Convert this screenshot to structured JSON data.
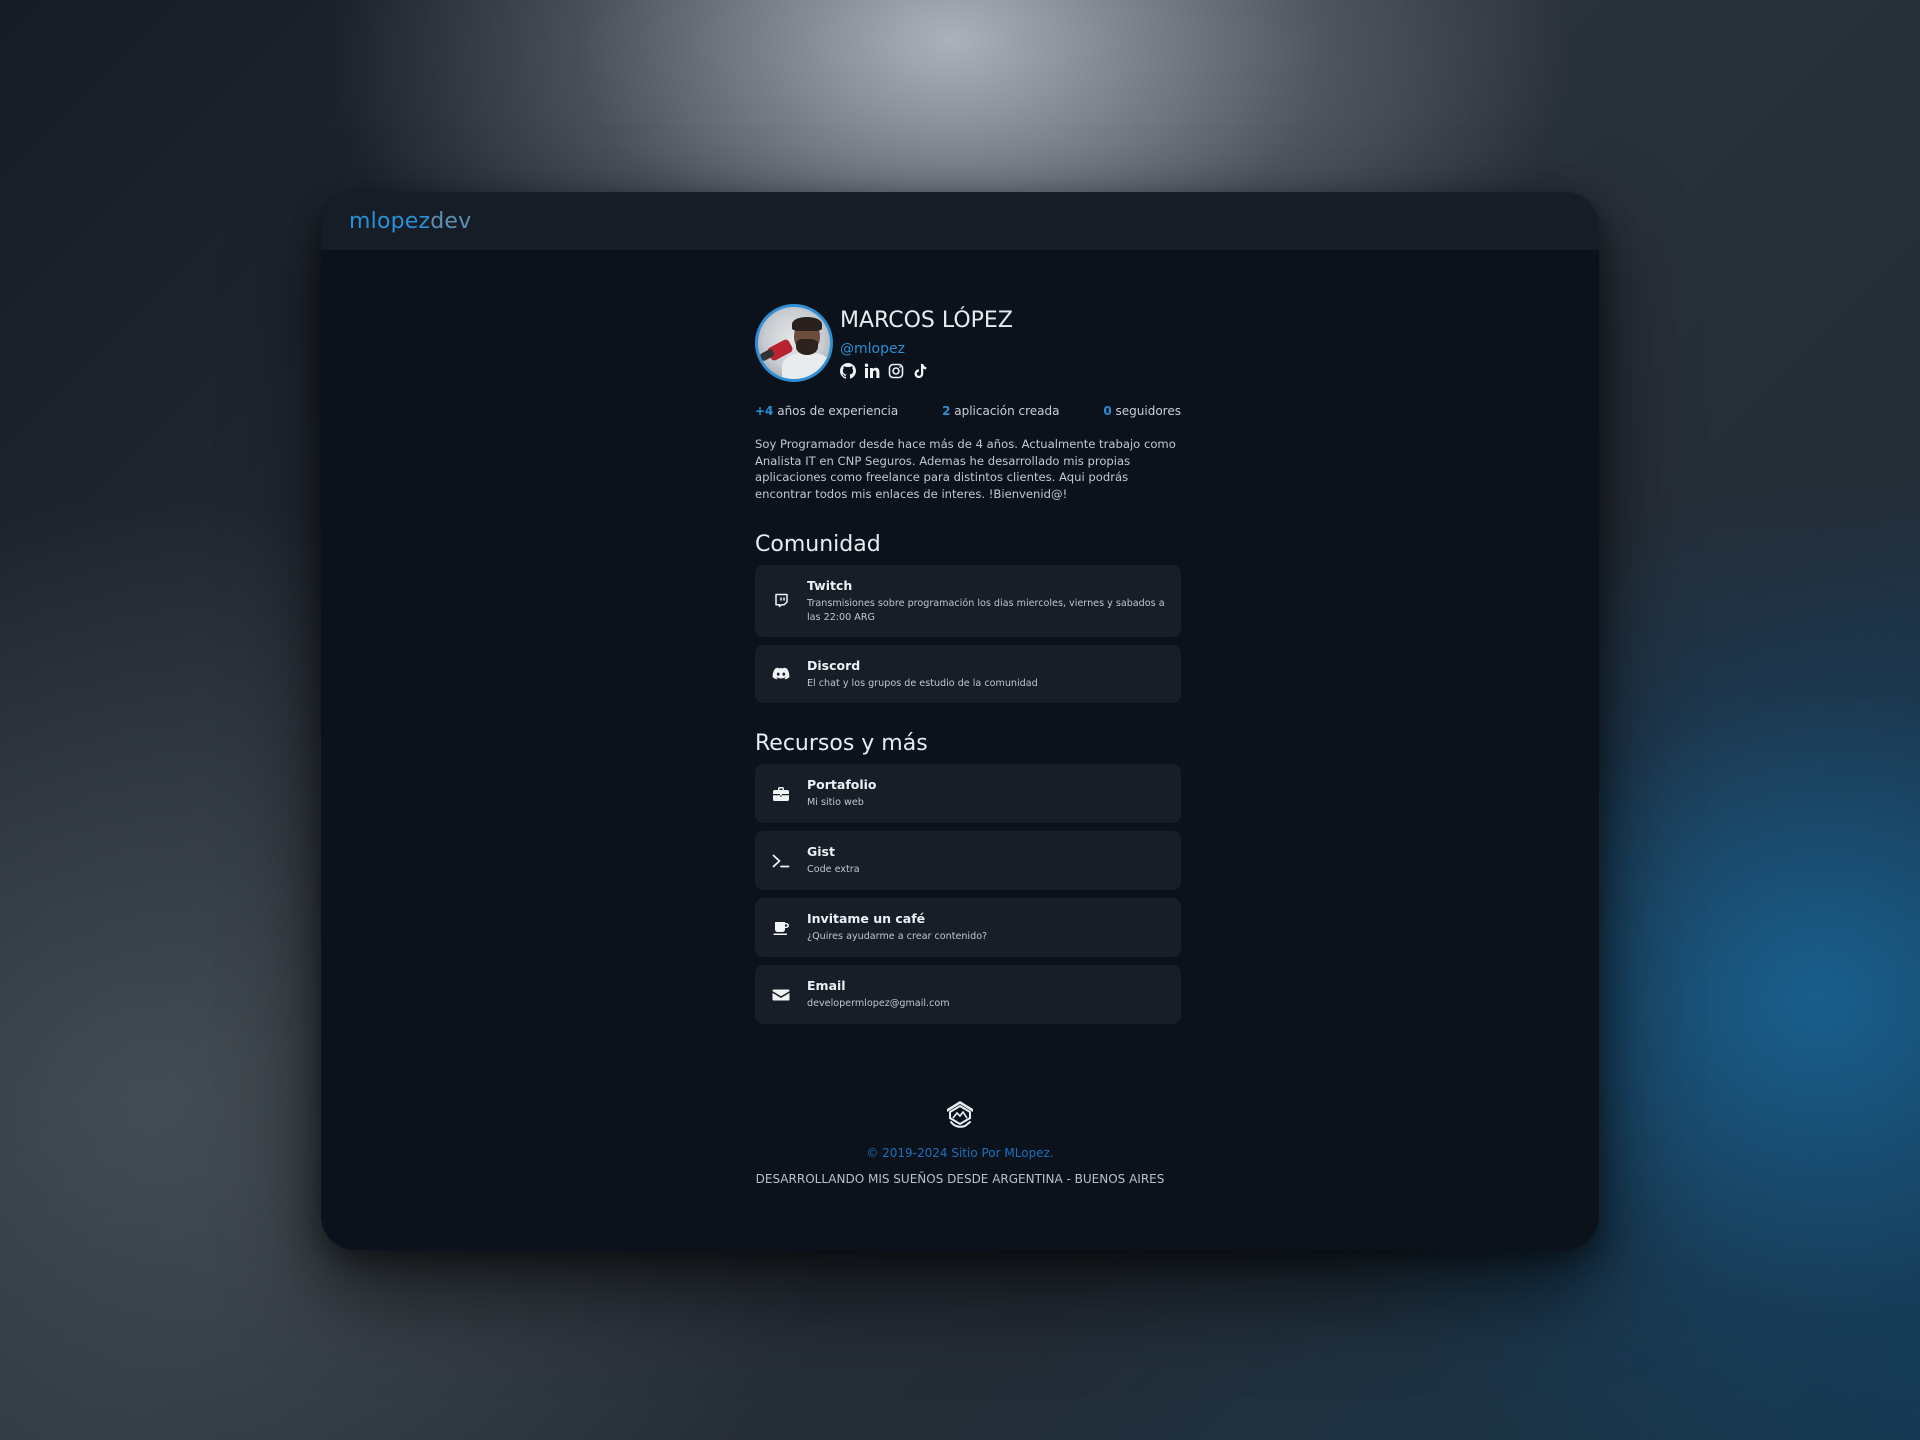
{
  "brand": {
    "part1": "mlopez",
    "part2": "dev"
  },
  "profile": {
    "name": "MARCOS LÓPEZ",
    "handle": "@mlopez",
    "socials": [
      "github-icon",
      "linkedin-icon",
      "instagram-icon",
      "tiktok-icon"
    ]
  },
  "stats": [
    {
      "num": "+4",
      "label": " años de experiencia"
    },
    {
      "num": "2",
      "label": " aplicación creada"
    },
    {
      "num": "0",
      "label": " seguidores"
    }
  ],
  "bio": "Soy Programador desde hace más de 4 años. Actualmente trabajo como Analista IT en CNP Seguros. Ademas he desarrollado mis propias aplicaciones como freelance para distintos clientes. Aqui podrás encontrar todos mis enlaces de interes. !Bienvenid@!",
  "comunidad": {
    "title": "Comunidad",
    "items": [
      {
        "icon": "twitch-icon",
        "title": "Twitch",
        "desc": "Transmisiones sobre programación los dias miercoles, viernes y sabados a las 22:00 ARG"
      },
      {
        "icon": "discord-icon",
        "title": "Discord",
        "desc": "El chat y los grupos de estudio de la comunidad"
      }
    ]
  },
  "recursos": {
    "title": "Recursos y más",
    "items": [
      {
        "icon": "briefcase-icon",
        "title": "Portafolio",
        "desc": "Mi sitio web"
      },
      {
        "icon": "terminal-icon",
        "title": "Gist",
        "desc": "Code extra"
      },
      {
        "icon": "coffee-icon",
        "title": "Invitame un café",
        "desc": "¿Quires ayudarme a crear contenido?"
      },
      {
        "icon": "email-icon",
        "title": "Email",
        "desc": "developermlopez@gmail.com"
      }
    ]
  },
  "footer": {
    "logo": "footer-logo-icon",
    "copyright": "© 2019-2024 Sitio Por MLopez.",
    "slogan": "DESARROLLANDO MIS SUEÑOS DESDE ARGENTINA - BUENOS AIRES"
  },
  "colors": {
    "accent": "#2a8fd4",
    "window_bg": "#0b121c",
    "card_bg": "#171e28",
    "navbar_bg": "#161d27"
  }
}
